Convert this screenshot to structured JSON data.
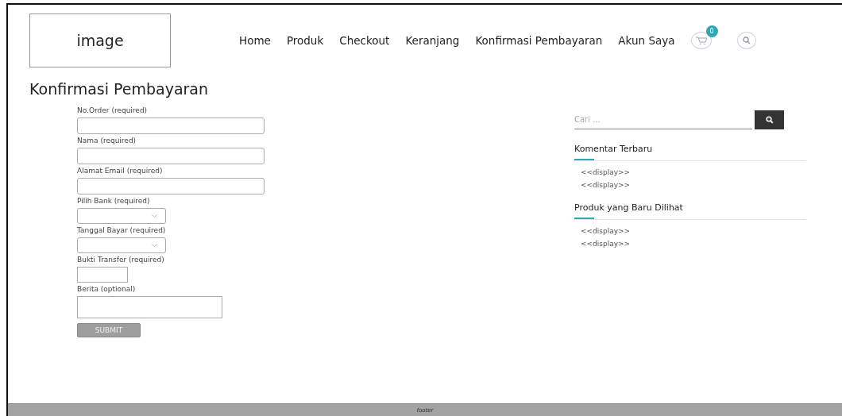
{
  "header": {
    "logo": "image",
    "nav": [
      {
        "label": "Home"
      },
      {
        "label": "Produk"
      },
      {
        "label": "Checkout"
      },
      {
        "label": "Keranjang"
      },
      {
        "label": "Konfirmasi Pembayaran"
      },
      {
        "label": "Akun Saya"
      }
    ],
    "cart_count": "0"
  },
  "page_title": "Konfirmasi Pembayaran",
  "form": {
    "fields": [
      {
        "label": "No.Order (required)",
        "kind": "text"
      },
      {
        "label": "Nama (required)",
        "kind": "text"
      },
      {
        "label": "Alamat Email (required)",
        "kind": "text"
      },
      {
        "label": "Pilih Bank (required)",
        "kind": "select"
      },
      {
        "label": "Tanggal Bayar (required)",
        "kind": "select"
      },
      {
        "label": "Bukti Transfer (required)",
        "kind": "file"
      },
      {
        "label": "Berita (optional)",
        "kind": "textarea"
      }
    ],
    "submit": "SUBMIT"
  },
  "sidebar": {
    "search": {
      "placeholder": "Cari ..."
    },
    "widgets": [
      {
        "title": "Komentar Terbaru",
        "items": [
          "<<display>>",
          "<<display>>"
        ]
      },
      {
        "title": "Produk yang Baru Dilihat",
        "items": [
          "<<display>>",
          "<<display>>"
        ]
      }
    ]
  },
  "footer": "footer"
}
